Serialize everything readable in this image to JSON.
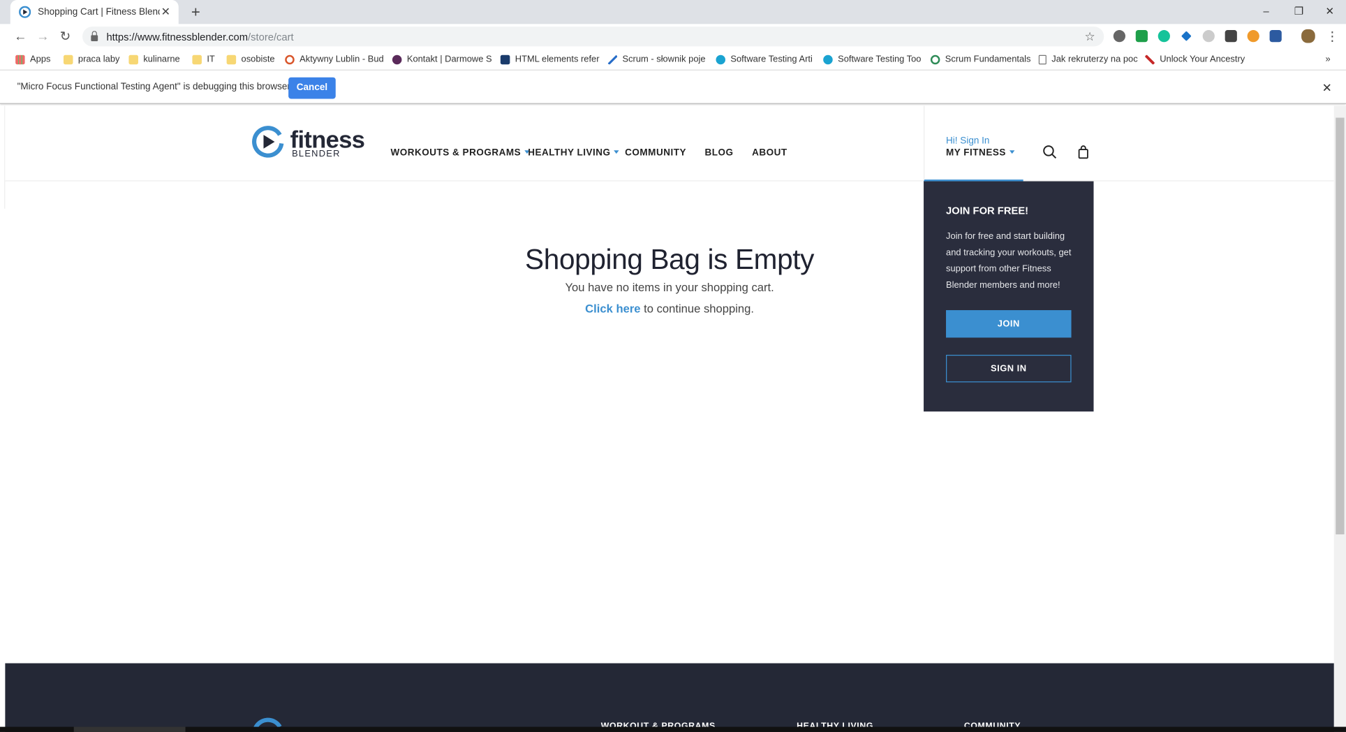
{
  "browser": {
    "tab_title": "Shopping Cart | Fitness Blender",
    "url_host": "https://www.fitnessblender.com",
    "url_path": "/store/cart",
    "new_tab_symbol": "+",
    "close_symbol": "✕",
    "minimize_symbol": "–",
    "restore_symbol": "❐",
    "window_close_symbol": "✕",
    "back_symbol": "←",
    "forward_symbol": "→",
    "reload_symbol": "↻",
    "bookmark_star": "☆",
    "menu_symbol": "⋮",
    "bookmarks_more": "»"
  },
  "bookmarks": [
    {
      "label": "Apps",
      "icon": "apps-grid-icon"
    },
    {
      "label": "praca laby",
      "icon": "folder-icon"
    },
    {
      "label": "kulinarne",
      "icon": "folder-icon"
    },
    {
      "label": "IT",
      "icon": "folder-icon"
    },
    {
      "label": "osobiste",
      "icon": "folder-icon"
    },
    {
      "label": "Aktywny Lublin - Bud",
      "icon": "site-icon"
    },
    {
      "label": "Kontakt | Darmowe S",
      "icon": "site-icon"
    },
    {
      "label": "HTML elements refer",
      "icon": "site-icon"
    },
    {
      "label": "Scrum - słownik poje",
      "icon": "site-icon"
    },
    {
      "label": "Software Testing Arti",
      "icon": "site-icon"
    },
    {
      "label": "Software Testing Too",
      "icon": "site-icon"
    },
    {
      "label": "Scrum Fundamentals",
      "icon": "site-icon"
    },
    {
      "label": "Jak rekruterzy na poc",
      "icon": "page-icon"
    },
    {
      "label": "Unlock Your Ancestry",
      "icon": "site-icon"
    }
  ],
  "debug_bar": {
    "message": "\"Micro Focus Functional Testing Agent\" is debugging this browser",
    "cancel_label": "Cancel",
    "close_symbol": "✕"
  },
  "site": {
    "logo_text": "fitness",
    "logo_sub": "BLENDER",
    "nav": {
      "workouts": "WORKOUTS & PROGRAMS",
      "healthy": "HEALTHY LIVING",
      "community": "COMMUNITY",
      "blog": "BLOG",
      "about": "ABOUT"
    },
    "account": {
      "greeting": "Hi! Sign In",
      "label": "MY FITNESS"
    },
    "dropdown": {
      "title": "JOIN FOR FREE!",
      "body": "Join for free and start building and tracking your workouts, get support from other Fitness Blender members and more!",
      "join_label": "JOIN",
      "signin_label": "SIGN IN"
    },
    "cart": {
      "heading": "Shopping Bag is Empty",
      "message": "You have no items in your shopping cart.",
      "link_text": "Click here",
      "link_suffix": " to continue shopping."
    },
    "footer": {
      "col1": "WORKOUT & PROGRAMS",
      "col2": "HEALTHY LIVING",
      "col3": "COMMUNITY"
    }
  },
  "colors": {
    "accent": "#3b8fd0",
    "dark": "#2a2d3d",
    "footer": "#242836",
    "chrome_button": "#3b82e8"
  }
}
